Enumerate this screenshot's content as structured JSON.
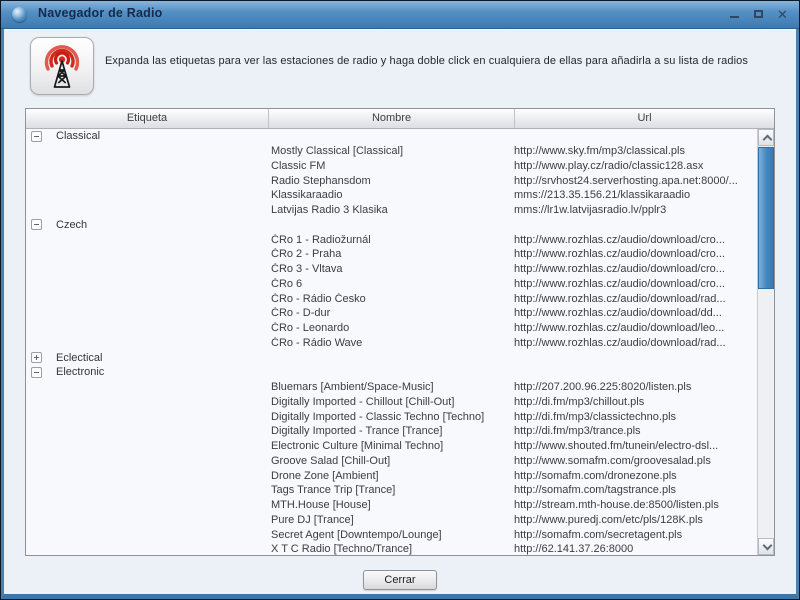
{
  "window": {
    "title": "Navegador de Radio"
  },
  "icons": {
    "app": "globe-sphere",
    "radio_tower": "antenna-with-waves",
    "minimize": "–",
    "maximize": "□",
    "close": "✕",
    "scroll_up": "∧",
    "scroll_down": "∨",
    "expander_expanded": "−",
    "expander_collapsed": "+"
  },
  "header": {
    "instruction": "Expanda las etiquetas para ver las estaciones de radio y haga doble click en cualquiera de ellas para añadirla a su lista de radios"
  },
  "table": {
    "columns": [
      "Etiqueta",
      "Nombre",
      "Url"
    ],
    "rows": [
      {
        "type": "group",
        "label": "Classical",
        "expanded": true
      },
      {
        "type": "station",
        "name": "Mostly Classical [Classical]",
        "url": "http://www.sky.fm/mp3/classical.pls"
      },
      {
        "type": "station",
        "name": "Classic FM",
        "url": "http://www.play.cz/radio/classic128.asx"
      },
      {
        "type": "station",
        "name": "Radio Stephansdom",
        "url": "http://srvhost24.serverhosting.apa.net:8000/..."
      },
      {
        "type": "station",
        "name": "Klassikaraadio",
        "url": "mms://213.35.156.21/klassikaraadio"
      },
      {
        "type": "station",
        "name": "Latvijas Radio 3 Klasika",
        "url": "mms://lr1w.latvijasradio.lv/pplr3"
      },
      {
        "type": "group",
        "label": "Czech",
        "expanded": true
      },
      {
        "type": "station",
        "name": "ČRo 1 - Radiožurnál",
        "url": "http://www.rozhlas.cz/audio/download/cro..."
      },
      {
        "type": "station",
        "name": "ČRo 2 - Praha",
        "url": "http://www.rozhlas.cz/audio/download/cro..."
      },
      {
        "type": "station",
        "name": "ČRo 3 - Vltava",
        "url": "http://www.rozhlas.cz/audio/download/cro..."
      },
      {
        "type": "station",
        "name": "ČRo 6",
        "url": "http://www.rozhlas.cz/audio/download/cro..."
      },
      {
        "type": "station",
        "name": "ČRo - Rádio Česko",
        "url": "http://www.rozhlas.cz/audio/download/rad..."
      },
      {
        "type": "station",
        "name": "ČRo - D-dur",
        "url": "http://www.rozhlas.cz/audio/download/dd..."
      },
      {
        "type": "station",
        "name": "ČRo - Leonardo",
        "url": "http://www.rozhlas.cz/audio/download/leo..."
      },
      {
        "type": "station",
        "name": "ČRo - Rádio Wave",
        "url": "http://www.rozhlas.cz/audio/download/rad..."
      },
      {
        "type": "group",
        "label": "Eclectical",
        "expanded": false
      },
      {
        "type": "group",
        "label": "Electronic",
        "expanded": true
      },
      {
        "type": "station",
        "name": "Bluemars [Ambient/Space-Music]",
        "url": "http://207.200.96.225:8020/listen.pls"
      },
      {
        "type": "station",
        "name": "Digitally Imported - Chillout [Chill-Out]",
        "url": "http://di.fm/mp3/chillout.pls"
      },
      {
        "type": "station",
        "name": "Digitally Imported - Classic Techno [Techno]",
        "url": "http://di.fm/mp3/classictechno.pls"
      },
      {
        "type": "station",
        "name": "Digitally Imported - Trance [Trance]",
        "url": "http://di.fm/mp3/trance.pls"
      },
      {
        "type": "station",
        "name": "Electronic Culture [Minimal Techno]",
        "url": "http://www.shouted.fm/tunein/electro-dsl..."
      },
      {
        "type": "station",
        "name": "Groove Salad [Chill-Out]",
        "url": "http://www.somafm.com/groovesalad.pls"
      },
      {
        "type": "station",
        "name": "Drone Zone [Ambient]",
        "url": "http://somafm.com/dronezone.pls"
      },
      {
        "type": "station",
        "name": "Tags Trance Trip [Trance]",
        "url": "http://somafm.com/tagstrance.pls"
      },
      {
        "type": "station",
        "name": "MTH.House [House]",
        "url": "http://stream.mth-house.de:8500/listen.pls"
      },
      {
        "type": "station",
        "name": "Pure DJ [Trance]",
        "url": "http://www.puredj.com/etc/pls/128K.pls"
      },
      {
        "type": "station",
        "name": "Secret Agent [Downtempo/Lounge]",
        "url": "http://somafm.com/secretagent.pls"
      },
      {
        "type": "station",
        "name": "X T C Radio [Techno/Trance]",
        "url": "http://62.141.37.26:8000"
      }
    ]
  },
  "footer": {
    "close_label": "Cerrar"
  },
  "colors": {
    "titlebar_blue": "#4f8cc0",
    "frame_blue": "#3f76a8",
    "scroll_thumb_blue": "#4187bf",
    "wave_red": "#d42a1e"
  }
}
